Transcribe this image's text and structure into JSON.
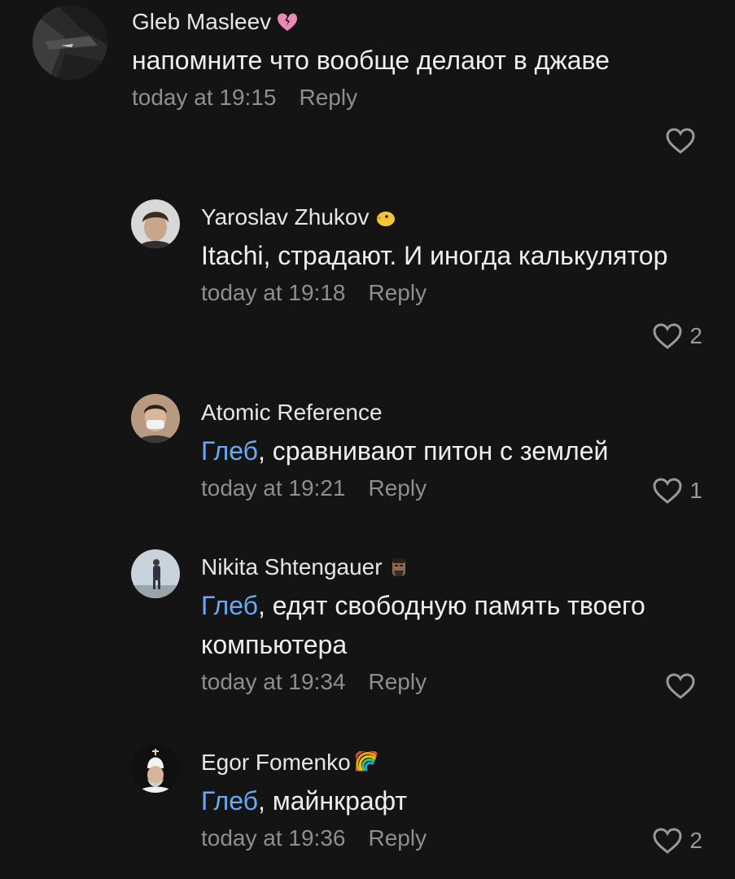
{
  "comments": [
    {
      "author": "Gleb Masleev",
      "author_emoji": "broken-heart-icon",
      "text_pre": "",
      "text": "напомните что вообще делают в джаве",
      "time": "today at 19:15",
      "reply_label": "Reply",
      "likes": ""
    },
    {
      "author": "Yaroslav Zhukov",
      "author_emoji": "chick-icon",
      "text_pre": "",
      "text": "Itachi, страдают. И иногда калькулятор",
      "time": "today at 19:18",
      "reply_label": "Reply",
      "likes": "2"
    },
    {
      "author": "Atomic Reference",
      "author_emoji": "",
      "mention": "Глеб",
      "text": ", сравнивают питон с землей",
      "time": "today at 19:21",
      "reply_label": "Reply",
      "likes": "1"
    },
    {
      "author": "Nikita Shtengauer",
      "author_emoji": "moai-face-icon",
      "mention": "Глеб",
      "text": ", едят свободную память твоего компьютера",
      "time": "today at 19:34",
      "reply_label": "Reply",
      "likes": ""
    },
    {
      "author": "Egor Fomenko",
      "author_emoji": "rainbow-icon",
      "mention": "Глеб",
      "text": ", майнкрафт",
      "time": "today at 19:36",
      "reply_label": "Reply",
      "likes": "2"
    }
  ],
  "colors": {
    "background": "#141414",
    "mention": "#6aa9f0",
    "meta": "#8e8e8e"
  }
}
